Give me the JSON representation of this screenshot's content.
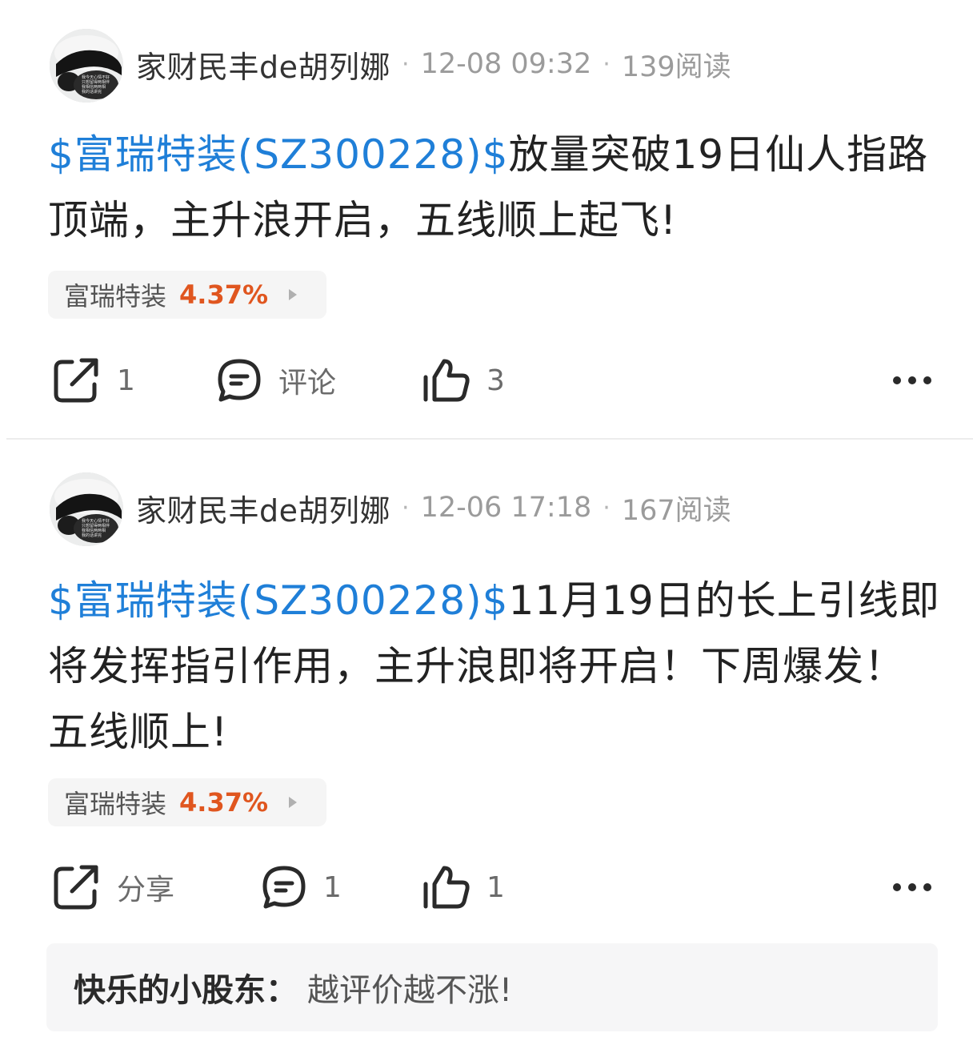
{
  "posts": [
    {
      "author": "家财民丰de胡列娜",
      "date": "12-08 09:32",
      "reads": "139阅读",
      "stock_link": "$富瑞特装(SZ300228)$",
      "body": "放量突破19日仙人指路顶端，主升浪开启，五线顺上起飞!",
      "chip": {
        "name": "富瑞特装",
        "change": "4.37%"
      },
      "actions": {
        "share": "1",
        "comment": "评论",
        "like": "3"
      }
    },
    {
      "author": "家财民丰de胡列娜",
      "date": "12-06 17:18",
      "reads": "167阅读",
      "stock_link": "$富瑞特装(SZ300228)$",
      "body": "11月19日的长上引线即将发挥指引作用，主升浪即将开启！下周爆发！五线顺上!",
      "chip": {
        "name": "富瑞特装",
        "change": "4.37%"
      },
      "actions": {
        "share": "分享",
        "comment": "1",
        "like": "1"
      },
      "comment": {
        "user": "快乐的小股东：",
        "text": "越评价越不涨!"
      }
    }
  ],
  "avatar_caption": [
    "我今天心情不好",
    "只想留得两相伴",
    "我相信两两相",
    "我的话讲完"
  ],
  "separator": "·",
  "colors": {
    "link": "#1f7fd8",
    "up": "#e0561f",
    "meta": "#9b9b9b",
    "chip_bg": "#f5f5f5"
  },
  "icons": [
    "share-icon",
    "comment-icon",
    "like-icon",
    "more-icon"
  ]
}
